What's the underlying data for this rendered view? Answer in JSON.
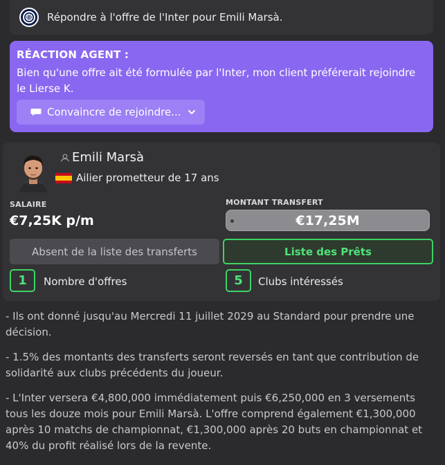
{
  "offer_banner": {
    "club_badge_icon": "inter-club-crest",
    "text": "Répondre à l'offre de l'Inter pour Emili Marsà."
  },
  "agent_reaction": {
    "title": "RÉACTION AGENT :",
    "message": "Bien qu'une offre ait été formulée par l'Inter, mon client préférerait rejoindre le Lierse K.",
    "persuade_button": "Convaincre de rejoindre...",
    "background_color": "#8a67f0"
  },
  "player": {
    "name": "Emili Marsà",
    "description": "Ailier prometteur de 17 ans",
    "nationality_flag": "spain-flag",
    "salary_label": "SALAIRE",
    "salary_value": "€7,25K p/m",
    "fee_label": "MONTANT TRANSFERT",
    "fee_value": "€17,25M"
  },
  "status_buttons": {
    "transfer_list": "Absent de la liste des transferts",
    "loan_list": "Liste des Prêts"
  },
  "stats": {
    "offers_count": "1",
    "offers_label": "Nombre d'offres",
    "clubs_count": "5",
    "clubs_label": "Clubs intéressés",
    "accent_color": "#3ed463"
  },
  "notes": [
    "- Ils ont donné jusqu'au Mercredi 11 juillet 2029 au Standard pour prendre une décision.",
    "- 1.5% des montants des transferts seront reversés en tant que contribution de solidarité aux clubs précédents du joueur.",
    "- L'Inter versera €4,800,000 immédiatement puis €6,250,000 en 3 versements tous les douze mois pour Emili Marsà. L'offre comprend également €1,300,000 après 10 matchs de championnat, €1,300,000 après 20 buts en championnat et 40% du profit réalisé lors de la revente."
  ]
}
